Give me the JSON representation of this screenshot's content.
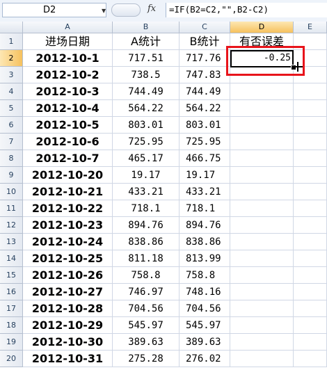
{
  "formula_bar": {
    "name_box": "D2",
    "formula": "=IF(B2=C2,\"\",B2-C2)",
    "fx_label": "fx"
  },
  "columns": [
    "A",
    "B",
    "C",
    "D",
    "E"
  ],
  "headers": {
    "a": "进场日期",
    "b": "A统计",
    "c": "B统计",
    "d": "有否误差"
  },
  "rows": [
    {
      "n": "1"
    },
    {
      "n": "2",
      "a": "2012-10-1",
      "b": "717.51",
      "c": "717.76",
      "d": "-0.25"
    },
    {
      "n": "3",
      "a": "2012-10-2",
      "b": "738.5",
      "c": "747.83",
      "d": ""
    },
    {
      "n": "4",
      "a": "2012-10-3",
      "b": "744.49",
      "c": "744.49",
      "d": ""
    },
    {
      "n": "5",
      "a": "2012-10-4",
      "b": "564.22",
      "c": "564.22",
      "d": ""
    },
    {
      "n": "6",
      "a": "2012-10-5",
      "b": "803.01",
      "c": "803.01",
      "d": ""
    },
    {
      "n": "7",
      "a": "2012-10-6",
      "b": "725.95",
      "c": "725.95",
      "d": ""
    },
    {
      "n": "8",
      "a": "2012-10-7",
      "b": "465.17",
      "c": "466.75",
      "d": ""
    },
    {
      "n": "9",
      "a": "2012-10-20",
      "b": "19.17",
      "c": "19.17",
      "d": ""
    },
    {
      "n": "10",
      "a": "2012-10-21",
      "b": "433.21",
      "c": "433.21",
      "d": ""
    },
    {
      "n": "11",
      "a": "2012-10-22",
      "b": "718.1",
      "c": "718.1",
      "d": ""
    },
    {
      "n": "12",
      "a": "2012-10-23",
      "b": "894.76",
      "c": "894.76",
      "d": ""
    },
    {
      "n": "13",
      "a": "2012-10-24",
      "b": "838.86",
      "c": "838.86",
      "d": ""
    },
    {
      "n": "14",
      "a": "2012-10-25",
      "b": "811.18",
      "c": "813.99",
      "d": ""
    },
    {
      "n": "15",
      "a": "2012-10-26",
      "b": "758.8",
      "c": "758.8",
      "d": ""
    },
    {
      "n": "16",
      "a": "2012-10-27",
      "b": "746.97",
      "c": "748.16",
      "d": ""
    },
    {
      "n": "17",
      "a": "2012-10-28",
      "b": "704.56",
      "c": "704.56",
      "d": ""
    },
    {
      "n": "18",
      "a": "2012-10-29",
      "b": "545.97",
      "c": "545.97",
      "d": ""
    },
    {
      "n": "19",
      "a": "2012-10-30",
      "b": "389.63",
      "c": "389.63",
      "d": ""
    },
    {
      "n": "20",
      "a": "2012-10-31",
      "b": "275.28",
      "c": "276.02",
      "d": ""
    }
  ],
  "colors": {
    "highlight_border": "#e8141b",
    "active_header": "#f6c15e"
  }
}
